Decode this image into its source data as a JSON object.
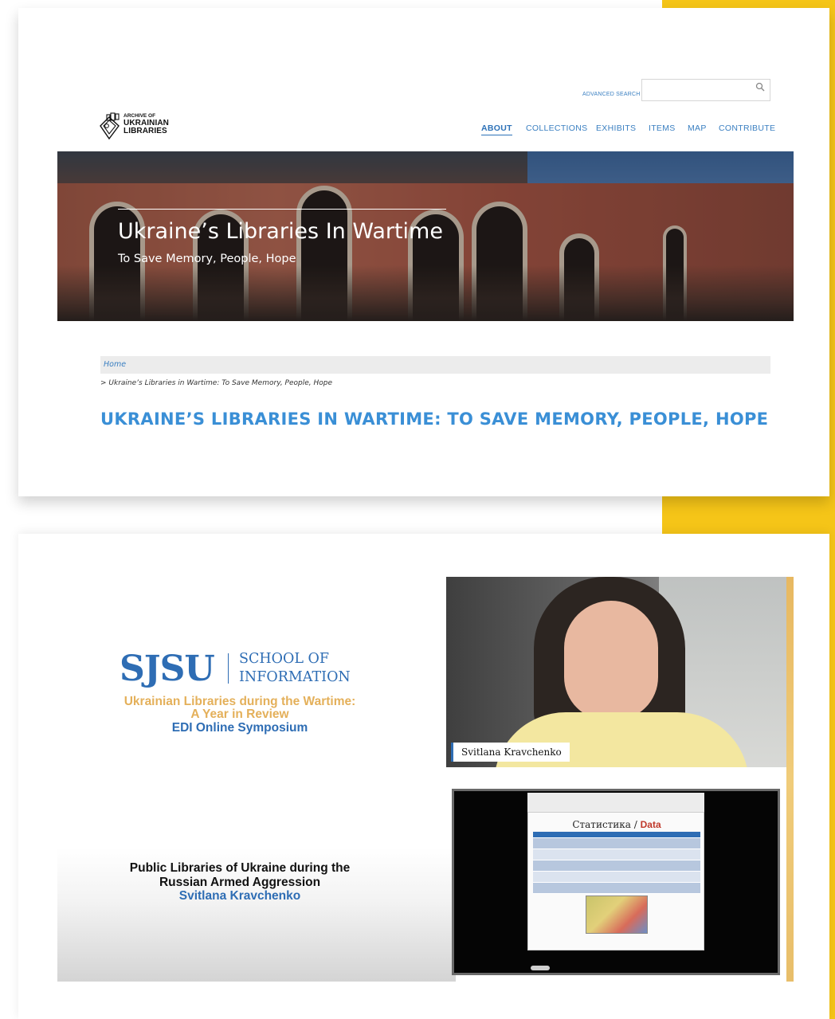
{
  "header": {
    "advanced_search": "ADVANCED SEARCH",
    "search_placeholder": "",
    "logo": {
      "line1": "ARCHIVE OF",
      "line2": "UKRAINIAN",
      "line3": "LIBRARIES"
    },
    "nav": [
      {
        "label": "ABOUT",
        "active": true
      },
      {
        "label": "COLLECTIONS"
      },
      {
        "label": "EXHIBITS"
      },
      {
        "label": "ITEMS"
      },
      {
        "label": "MAP"
      },
      {
        "label": "CONTRIBUTE"
      }
    ]
  },
  "hero": {
    "title": "Ukraine’s Libraries In Wartime",
    "subtitle": "To Save Memory, People, Hope"
  },
  "breadcrumb": {
    "home": "Home",
    "current": "> Ukraine’s Libraries in Wartime: To Save Memory, People, Hope"
  },
  "page_title": "UKRAINE’S LIBRARIES IN WARTIME: TO SAVE MEMORY, PEOPLE, HOPE",
  "video": {
    "sjsu": "SJSU",
    "school_line1": "SCHOOL OF",
    "school_line2": "INFORMATION",
    "symposium_line1": "Ukrainian Libraries during the Wartime:",
    "symposium_line2": "A Year in Review",
    "symposium_line3": "EDI Online Symposium",
    "talk_line1": "Public Libraries of Ukraine during the",
    "talk_line2": "Russian Armed Aggression",
    "talk_speaker": "Svitlana Kravchenko",
    "speaker_label": "Svitlana Kravchenko",
    "slide_title_left": "Статистика /",
    "slide_title_right": "Data"
  },
  "colors": {
    "accent": "#f5c518",
    "link": "#3a7fc1",
    "title": "#3a8fd6",
    "sjsu_blue": "#2e6db4",
    "gold": "#e4b05a"
  }
}
